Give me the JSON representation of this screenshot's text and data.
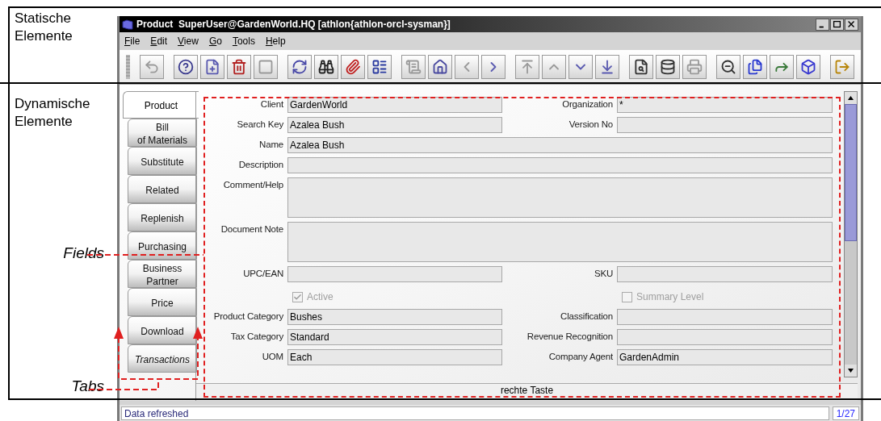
{
  "annotations": {
    "static_label": "Statische\nElemente",
    "dynamic_label": "Dynamische\nElemente",
    "fields_label": "Fields",
    "tabs_label": "Tabs"
  },
  "window": {
    "title": "Product  SuperUser@GardenWorld.HQ [athlon{athlon-orcl-sysman}]"
  },
  "menu": [
    "File",
    "Edit",
    "View",
    "Go",
    "Tools",
    "Help"
  ],
  "toolbar": [
    [
      {
        "kind": "undo",
        "disabled": true
      }
    ],
    [
      {
        "kind": "help",
        "disabled": false
      },
      {
        "kind": "new",
        "disabled": false
      },
      {
        "kind": "delete",
        "disabled": false
      },
      {
        "kind": "save",
        "disabled": true
      }
    ],
    [
      {
        "kind": "refresh",
        "disabled": false
      },
      {
        "kind": "find",
        "disabled": false
      },
      {
        "kind": "attachment",
        "disabled": false
      },
      {
        "kind": "grid",
        "disabled": false
      }
    ],
    [
      {
        "kind": "history",
        "disabled": true
      },
      {
        "kind": "home",
        "disabled": false
      },
      {
        "kind": "previous",
        "disabled": true
      },
      {
        "kind": "next",
        "disabled": false
      }
    ],
    [
      {
        "kind": "first",
        "disabled": true
      },
      {
        "kind": "up",
        "disabled": true
      },
      {
        "kind": "down",
        "disabled": false
      },
      {
        "kind": "last",
        "disabled": false
      }
    ],
    [
      {
        "kind": "report",
        "disabled": false
      },
      {
        "kind": "archive",
        "disabled": false
      },
      {
        "kind": "print",
        "disabled": true
      }
    ],
    [
      {
        "kind": "zoom",
        "disabled": false
      },
      {
        "kind": "documents",
        "disabled": false
      },
      {
        "kind": "workflow",
        "disabled": false
      },
      {
        "kind": "product",
        "disabled": false
      }
    ],
    [
      {
        "kind": "exit",
        "disabled": false
      }
    ]
  ],
  "tabs": [
    {
      "label": "Product",
      "selected": true,
      "italic": false
    },
    {
      "label": "Bill\nof Materials",
      "selected": false,
      "italic": false
    },
    {
      "label": "Substitute",
      "selected": false,
      "italic": false
    },
    {
      "label": "Related",
      "selected": false,
      "italic": false
    },
    {
      "label": "Replenish",
      "selected": false,
      "italic": false
    },
    {
      "label": "Purchasing",
      "selected": false,
      "italic": false
    },
    {
      "label": "Business\nPartner",
      "selected": false,
      "italic": false
    },
    {
      "label": "Price",
      "selected": false,
      "italic": false
    },
    {
      "label": "Download",
      "selected": false,
      "italic": false
    },
    {
      "label": "Transactions",
      "selected": false,
      "italic": true
    }
  ],
  "form": {
    "rows": [
      {
        "fields": [
          {
            "kind": "text",
            "label": "Client",
            "value": "GardenWorld"
          },
          {
            "kind": "text",
            "label": "Organization",
            "value": "*"
          }
        ]
      },
      {
        "fields": [
          {
            "kind": "text",
            "label": "Search Key",
            "value": "Azalea Bush"
          },
          {
            "kind": "text",
            "label": "Version No"
          }
        ]
      },
      {
        "fields": [
          {
            "kind": "text",
            "label": "Name",
            "value": "Azalea Bush"
          }
        ]
      },
      {
        "fields": [
          {
            "kind": "text",
            "label": "Description"
          }
        ]
      },
      {
        "fields": [
          {
            "kind": "area",
            "label": "Comment/Help"
          }
        ]
      },
      {
        "fields": [
          {
            "kind": "area",
            "label": "Document Note"
          }
        ]
      },
      {
        "fields": [
          {
            "kind": "text",
            "label": "UPC/EAN"
          },
          {
            "kind": "text",
            "label": "SKU"
          }
        ]
      },
      {
        "fields": [
          {
            "kind": "checkbox",
            "label": "Active",
            "checked": true,
            "disabled": true
          },
          {
            "kind": "checkbox",
            "label": "Summary Level",
            "checked": false,
            "disabled": true
          }
        ]
      },
      {
        "fields": [
          {
            "kind": "text",
            "label": "Product Category",
            "value": "Bushes"
          },
          {
            "kind": "text",
            "label": "Classification"
          }
        ]
      },
      {
        "fields": [
          {
            "kind": "text",
            "label": "Tax Category",
            "value": "Standard"
          },
          {
            "kind": "text",
            "label": "Revenue Recognition"
          }
        ]
      },
      {
        "fields": [
          {
            "kind": "text",
            "label": "UOM",
            "value": "Each"
          },
          {
            "kind": "text",
            "label": "Company Agent",
            "value": "GardenAdmin"
          }
        ]
      }
    ],
    "footer": "rechte Taste"
  },
  "status_bar": {
    "message": "Data refreshed",
    "record": "1/27"
  }
}
